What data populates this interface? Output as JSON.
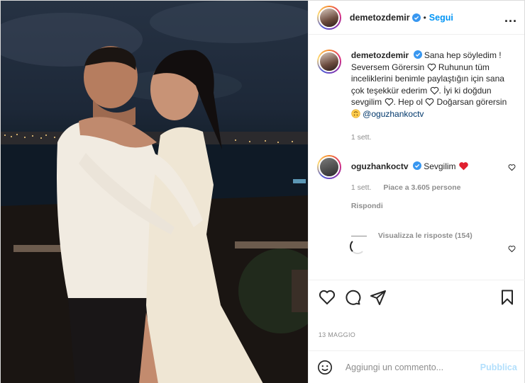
{
  "post": {
    "username": "demetozdemir",
    "follow_label": "Segui",
    "separator": "•",
    "more_label": "...",
    "caption": {
      "username": "demetozdemir",
      "parts": [
        "Sana hep söyledim ! Seversem Görersin ",
        " Ruhunun tüm inceliklerini benimle paylaştığın için sana çok teşekkür ederim ",
        ". İyi ki doğdun sevgilim ",
        ". Hep ol ",
        " Doğarsan görersin ",
        " "
      ],
      "mention": "@oguzhankoctv",
      "time": "1 sett."
    },
    "comment": {
      "username": "oguzhankoctv",
      "text": "Sevgilim",
      "time": "1 sett.",
      "likes": "Piace a 3.605 persone",
      "reply_label": "Rispondi",
      "view_replies": "Visualizza le risposte (154)"
    },
    "date": "13 MAGGIO",
    "add_comment_placeholder": "Aggiungi un commento...",
    "publish_label": "Pubblica"
  },
  "icons": {
    "verified": "verified-badge-icon",
    "heart": "heart-icon",
    "comment": "comment-icon",
    "share": "share-icon",
    "save": "save-icon",
    "emoji": "emoji-icon",
    "more": "more-options-icon"
  },
  "colors": {
    "link": "#0095f6",
    "publish_disabled": "#b2dffc",
    "muted": "#8e8e8e",
    "heart_red": "#ed4956"
  }
}
